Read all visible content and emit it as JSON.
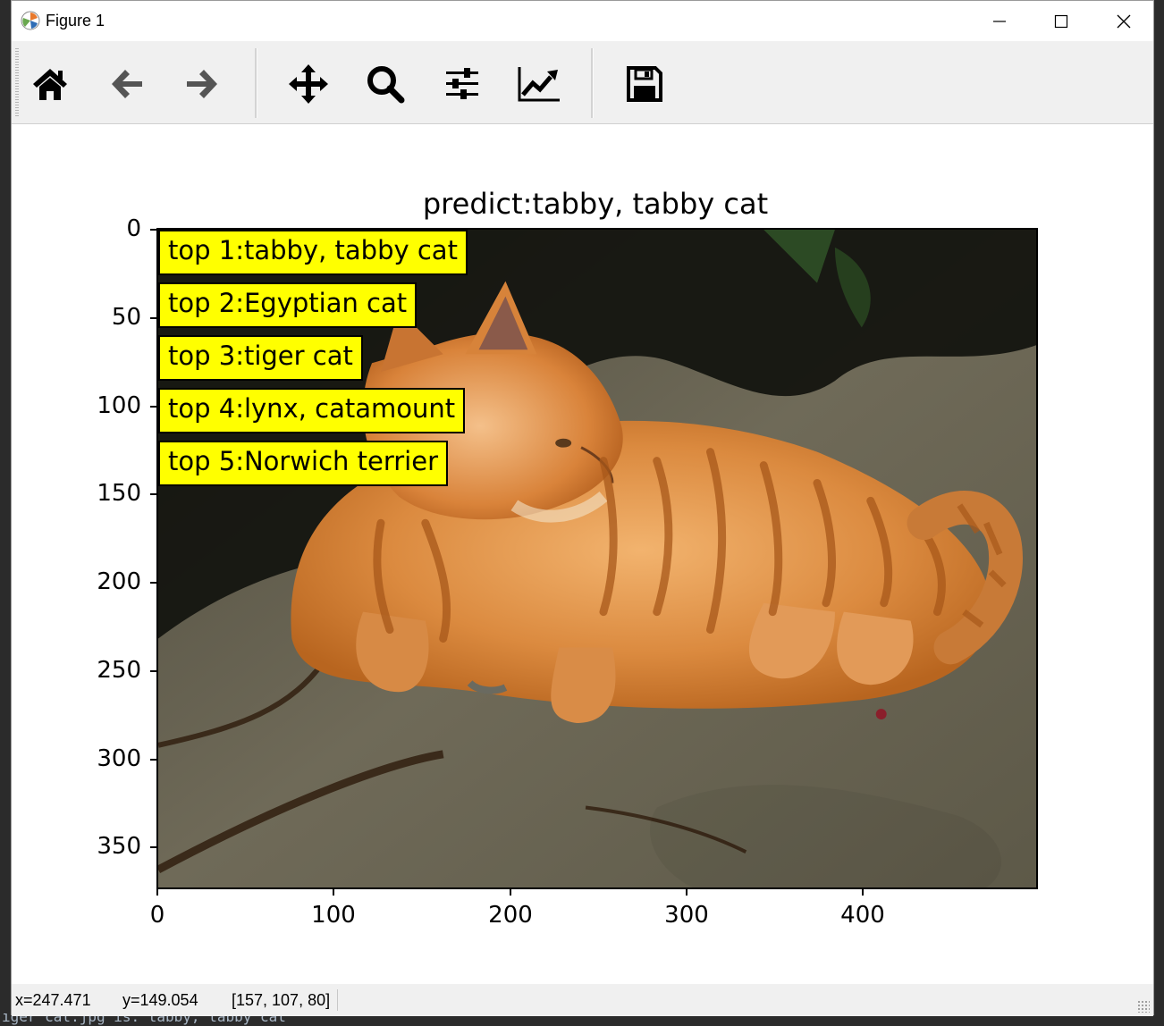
{
  "window": {
    "title": "Figure 1"
  },
  "toolbar": {
    "buttons": [
      {
        "name": "home",
        "icon": "home-icon"
      },
      {
        "name": "back",
        "icon": "arrow-left-icon"
      },
      {
        "name": "forward",
        "icon": "arrow-right-icon"
      },
      {
        "name": "pan",
        "icon": "move-icon"
      },
      {
        "name": "zoom",
        "icon": "magnifier-icon"
      },
      {
        "name": "configure-subplots",
        "icon": "sliders-icon"
      },
      {
        "name": "edit-axis",
        "icon": "chart-line-icon"
      },
      {
        "name": "save",
        "icon": "floppy-disk-icon"
      }
    ]
  },
  "figure": {
    "title": "predict:tabby, tabby cat",
    "image": "photo of an orange tabby cat lying on concrete",
    "labels": [
      "top 1:tabby, tabby cat",
      "top 2:Egyptian cat",
      "top 3:tiger cat",
      "top 4:lynx, catamount",
      "top 5:Norwich terrier"
    ],
    "yticks": [
      "0",
      "50",
      "100",
      "150",
      "200",
      "250",
      "300",
      "350"
    ],
    "xticks": [
      "0",
      "100",
      "200",
      "300",
      "400"
    ]
  },
  "status": {
    "x": "x=247.471",
    "y": "y=149.054",
    "pixel": "[157, 107, 80]"
  },
  "background_terminal": {
    "text": "iger cat.jpg is: tabby, tabby cat"
  }
}
